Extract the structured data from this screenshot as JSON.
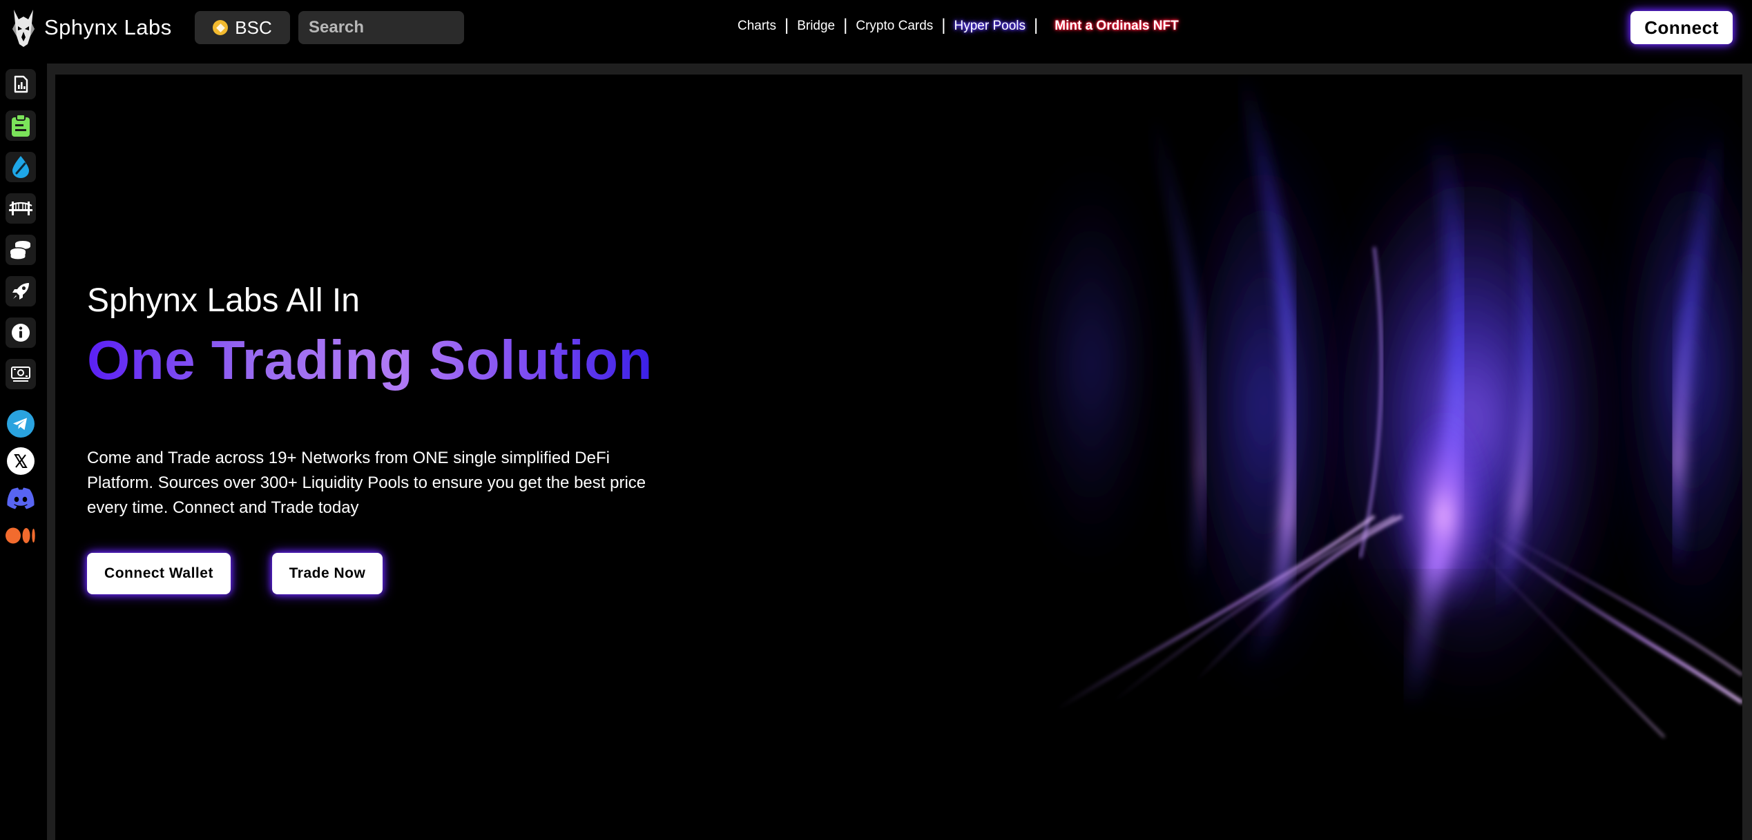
{
  "header": {
    "brand_name": "Sphynx Labs",
    "network_label": "BSC",
    "search_placeholder": "Search",
    "nav": {
      "charts": "Charts",
      "bridge": "Bridge",
      "crypto_cards": "Crypto Cards",
      "hyper_pools": "Hyper Pools",
      "mint": "Mint a Ordinals NFT",
      "separator": "|"
    },
    "connect_label": "Connect"
  },
  "sidebar": {
    "items": [
      {
        "icon": "charts-icon"
      },
      {
        "icon": "clipboard-icon"
      },
      {
        "icon": "liquidity-drop-icon"
      },
      {
        "icon": "bridge-icon"
      },
      {
        "icon": "coin-stack-icon"
      },
      {
        "icon": "rocket-icon"
      },
      {
        "icon": "info-icon"
      },
      {
        "icon": "cash-icon"
      }
    ],
    "socials": [
      {
        "icon": "telegram-icon"
      },
      {
        "icon": "x-twitter-icon"
      },
      {
        "icon": "discord-icon"
      },
      {
        "icon": "medium-icon"
      }
    ]
  },
  "hero": {
    "kicker": "Sphynx Labs All In",
    "title": "One Trading Solution",
    "description": "Come and Trade across 19+ Networks from ONE single simplified DeFi Platform. Sources over 300+ Liquidity Pools to ensure you get the best price every time. Connect and Trade today",
    "connect_wallet_label": "Connect Wallet",
    "trade_now_label": "Trade Now"
  },
  "colors": {
    "background": "#000000",
    "panel": "#1f1f1f",
    "accent_purple": "#6b2cff",
    "title_gradient_start": "#5a20f4",
    "title_gradient_mid": "#b07af4",
    "title_gradient_end": "#3a1fe6",
    "mint_glow": "#ff1e3c",
    "clipboard_green": "#7be35a",
    "liquidity_blue": "#1ea7e8",
    "telegram_blue": "#2aa3df",
    "discord_blue": "#5865f2",
    "medium_orange": "#f26b2e"
  }
}
